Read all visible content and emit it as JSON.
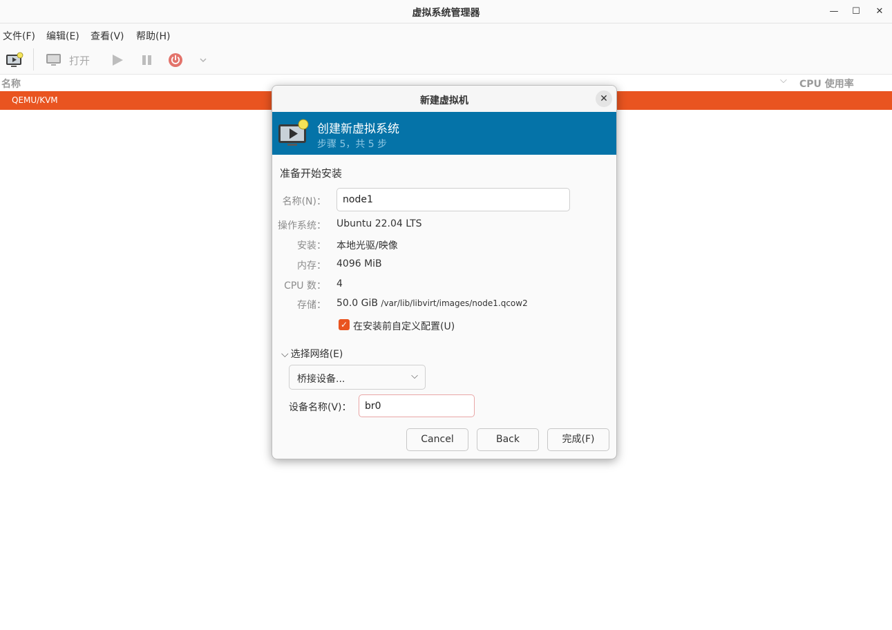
{
  "window": {
    "title": "虚拟系统管理器",
    "controls": {
      "minimize": "—",
      "maximize": "☐",
      "close": "✕"
    }
  },
  "menu": [
    "文件(F)",
    "编辑(E)",
    "查看(V)",
    "帮助(H)"
  ],
  "toolbar": {
    "new_vm_icon": "new-vm-icon",
    "open_label": "打开",
    "run_icon": "play-icon",
    "pause_icon": "pause-icon",
    "power_icon": "power-icon",
    "dropdown_icon": "chevron-down-icon"
  },
  "list": {
    "col_name": "名称",
    "col_cpu": "CPU 使用率",
    "rows": [
      "QEMU/KVM"
    ],
    "selection_color": "#e95420"
  },
  "dialog": {
    "title": "新建虚拟机",
    "banner": {
      "title": "创建新虚拟系统",
      "subtitle": "步骤 5，共 5 步",
      "color": "#0573a8"
    },
    "section_title": "准备开始安装",
    "fields": {
      "name_label": "名称(N)：",
      "name_value": "node1",
      "os_label": "操作系统：",
      "os_value": "Ubuntu 22.04 LTS",
      "install_label": "安装：",
      "install_value": "本地光驱/映像",
      "memory_label": "内存：",
      "memory_value": "4096 MiB",
      "cpu_label": "CPU 数：",
      "cpu_value": "4",
      "storage_label": "存储：",
      "storage_size": "50.0 GiB",
      "storage_path": "/var/lib/libvirt/images/node1.qcow2"
    },
    "customize_checkbox": {
      "label": "在安装前自定义配置(U)",
      "checked": true
    },
    "network": {
      "expander_label": "选择网络(E)",
      "selected_option": "桥接设备...",
      "device_label": "设备名称(V)：",
      "device_value": "br0"
    },
    "buttons": {
      "cancel": "Cancel",
      "back": "Back",
      "finish": "完成(F)"
    }
  }
}
